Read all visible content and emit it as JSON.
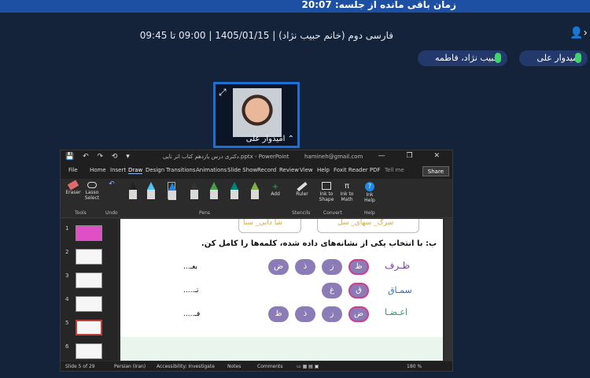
{
  "header": {
    "timer_text": "زمان باقی مانده از جلسه: 20:07",
    "session_info": "فارسی دوم (خانم حبیب نژاد) | 1405/01/15 | 09:00 تا 09:45",
    "user_menu": "👤›"
  },
  "participants": [
    {
      "name": "امیدوار علی"
    },
    {
      "name": "حبیب نژاد، فاطمه"
    }
  ],
  "video": {
    "name": "امیدوار علی",
    "expand_icon": "⤢",
    "caret": "⌃"
  },
  "ppt": {
    "quick_access": "💾 ↶ ↷ ⟲ ▾",
    "doc_title": "دکتری درس یازدهم کتاب اثر تایی.pptx  -  PowerPoint",
    "account": "hamineh@gmail.com",
    "window_controls": "— ❐ ✕",
    "tabs": [
      "File",
      "Home",
      "Insert",
      "Draw",
      "Design",
      "Transitions",
      "Animations",
      "Slide Show",
      "Record",
      "Review",
      "View",
      "Help",
      "Foxit Reader PDF",
      "Tell me"
    ],
    "active_tab": "Draw",
    "share_label": "Share",
    "ribbon": {
      "eraser": "Eraser",
      "lasso": "Lasso Select",
      "tools_group": "Tools",
      "undo_group": "Undo",
      "add": "Add",
      "pens_group": "Pens",
      "ruler": "Ruler",
      "stencils_group": "Stencils",
      "ink_to_shape": "Ink to Shape",
      "ink_to_math": "Ink to Math",
      "convert_group": "Convert",
      "ink_help": "Ink Help",
      "help_group": "Help"
    },
    "thumbnails": [
      "1",
      "2",
      "3",
      "4",
      "5",
      "6"
    ],
    "slide": {
      "top_words": [
        "سرگ_ سهای_ سل",
        "شا دابی_ سنا"
      ],
      "instruction": "ب: با انتخاب یکی از نشانه‌های داده شده، کلمه‌ها را کامل کن.",
      "rows": [
        {
          "left": "بعـ...",
          "choices": [
            "ض",
            "ذ",
            "ز",
            "ظ"
          ],
          "right": "ظـرف"
        },
        {
          "left": "تـ.....",
          "choices": [
            "غ",
            "ق"
          ],
          "right": "سمـاق"
        },
        {
          "left": "فـ.....",
          "choices": [
            "ظ",
            "ذ",
            "ز",
            "ض"
          ],
          "right": "اعـضـا"
        }
      ]
    },
    "status": {
      "slide_of": "Slide 5 of 29",
      "language": "Persian (Iran)",
      "accessibility": "Accessibility: Investigate",
      "notes": "Notes",
      "comments": "Comments",
      "zoom": "180 %"
    }
  }
}
